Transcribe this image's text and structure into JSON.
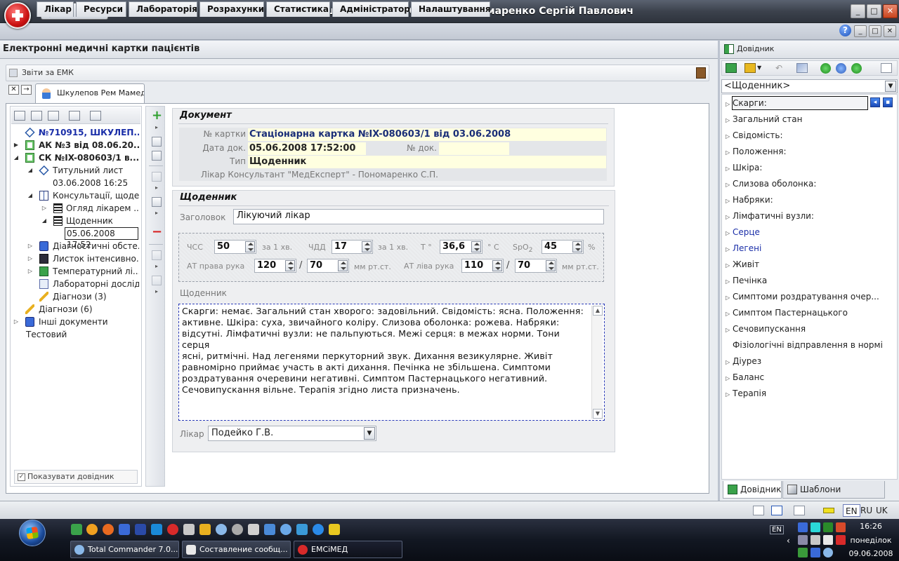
{
  "window": {
    "title": "Робоче місце лікаря - ЕМСіМЕД® Пономаренко Сергій Павлович",
    "quick_access_more": "»",
    "btn_minimize": "_",
    "btn_maximize": "□",
    "btn_close": "✕"
  },
  "menu": {
    "items": [
      "Лікар",
      "Ресурси",
      "Лабораторія",
      "Розрахунки",
      "Статистика",
      "Адміністратор",
      "Налаштування"
    ],
    "help": "?"
  },
  "main": {
    "header": "Електронні медичні картки пацієнтів",
    "reports": "Звіти за ЕМК",
    "patient_tab": "Шкулепов Рем Мамед...",
    "show_help": "Показувати довідник"
  },
  "tree": {
    "items": [
      "№710915, ШКУЛЕП...",
      "АК №3 від 08.06.20...",
      "СК №IX-080603/1 в...",
      "Титульний лист",
      "03.06.2008 16:25",
      "Консультації, щоде...",
      "Огляд лікарем ...",
      "Щоденник",
      "05.06.2008 17:52",
      "Діагностичні обсте...",
      "Листок інтенсивно...",
      "Температурний лі...",
      "Лабораторні дослід...",
      "Діагнози (3)",
      "Діагнози (6)",
      "Інші документи",
      "Тестовий"
    ]
  },
  "document": {
    "section_title": "Документ",
    "card_label": "№ картки",
    "card_value": "Стаціонарна картка №IX-080603/1 від 03.06.2008",
    "date_label": "Дата док.",
    "date_value": "05.06.2008 17:52:00",
    "docnum_label": "№ док.",
    "docnum_value": "",
    "type_label": "Тип",
    "type_value": "Щоденник",
    "consultant": "Лікар Консультант \"МедЕксперт\" - Пономаренко С.П."
  },
  "diary": {
    "section_title": "Щоденник",
    "heading_label": "Заголовок",
    "heading_value": "Лікуючий лікар",
    "vitals": {
      "hr_label": "ЧСС",
      "hr_value": "50",
      "hr_unit": "за 1 хв.",
      "rr_label": "ЧДД",
      "rr_value": "17",
      "rr_unit": "за 1 хв.",
      "temp_label": "Т °",
      "temp_value": "36,6",
      "temp_unit": "° С",
      "spo2_label": "SpO",
      "spo2_sub": "2",
      "spo2_value": "45",
      "spo2_unit": "%",
      "bp_right_label": "АТ права рука",
      "bp_right_sys": "120",
      "bp_right_dia": "70",
      "bp_left_label": "АТ ліва рука",
      "bp_left_sys": "110",
      "bp_left_dia": "70",
      "bp_sep": "/",
      "bp_unit": "мм рт.ст."
    },
    "text_label": "Щоденник",
    "text_lines": [
      "Скарги: немає. Загальний стан хворого: задовільний. Свідомість: ясна. Положення:",
      "активне. Шкіра: суха, звичайного коліру. Слизова оболонка: рожева. Набряки:",
      "відсутні. Лімфатичні вузли: не пальпуються. Межі серця: в межах норми. Тони серця",
      "ясні, ритмічні. Над легенями перкуторний звук. Дихання везикулярне. Живіт",
      "равномірно приймає участь в акті дихання. Печінка не збільшена. Симптоми",
      "роздратування очеревини негативні. Симптом Пастернацького негативний.",
      "Сечовипускання вільне. Терапія згідно листа призначень."
    ],
    "doctor_label": "Лікар",
    "doctor_value": "Подейко Г.В."
  },
  "right_panel": {
    "header": "Довідник",
    "combo": "<Щоденник>",
    "items": [
      "Скарги:",
      "Загальний стан",
      "Свідомість:",
      "Положення:",
      "Шкіра:",
      "Слизова оболонка:",
      "Набряки:",
      "Лімфатичні вузли:",
      "Серце",
      "Легені",
      "Живіт",
      "Печінка",
      "Симптоми роздратування очер...",
      "Симптом Пастернацького",
      "Сечовипускання",
      "Фізіологічні відправлення в нормі",
      "Діурез",
      "Баланс",
      "Терапія"
    ],
    "tab_reference": "Довідник",
    "tab_templates": "Шаблони заповнення"
  },
  "status": {
    "lang_en": "EN",
    "lang_ru": "RU",
    "lang_uk": "UK"
  },
  "taskbar": {
    "tasks": [
      "Total Commander 7.0...",
      "Составление сообщ...",
      "ЕМСіМЕД"
    ],
    "tray_lang": "EN",
    "time": "16:26",
    "day": "понеділок",
    "date": "09.06.2008"
  },
  "colors": {
    "accent_blue": "#1a2ea8",
    "field_yellow": "#ffffe0",
    "add_green": "#2ea02e",
    "delete_red": "#d82020"
  }
}
